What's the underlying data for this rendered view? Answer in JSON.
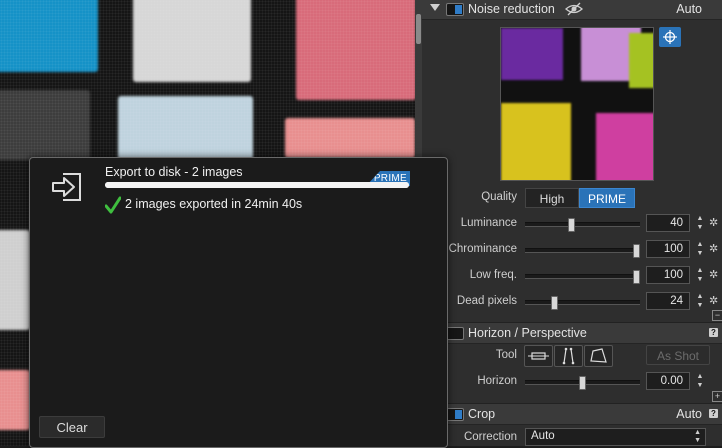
{
  "photo": {
    "colors": {
      "cyan": "#1592c7",
      "white": "#d7d7d7",
      "pink": "#d86b7a",
      "skyblue": "#bfd3de",
      "salmon": "#e88f8f",
      "gray": "#8a8a8a",
      "lightgray": "#cfcfcf"
    }
  },
  "noise_reduction": {
    "title": "Noise reduction",
    "auto": "Auto",
    "visibility_icon": "eye-hidden-icon",
    "picker_icon": "crosshair-icon",
    "quality_label": "Quality",
    "quality_options": [
      "High",
      "PRIME"
    ],
    "quality_selected": "PRIME",
    "sliders": [
      {
        "label": "Luminance",
        "value": "40",
        "level": 0.4
      },
      {
        "label": "Chrominance",
        "value": "100",
        "level": 1.0
      },
      {
        "label": "Low freq.",
        "value": "100",
        "level": 1.0
      },
      {
        "label": "Dead pixels",
        "value": "24",
        "level": 0.24
      }
    ]
  },
  "horizon": {
    "title": "Horizon / Perspective",
    "tool_label": "Tool",
    "as_shot": "As Shot",
    "horizon_label": "Horizon",
    "horizon_value": "0.00",
    "horizon_level": 0.5
  },
  "crop": {
    "title": "Crop",
    "auto": "Auto",
    "correction_label": "Correction",
    "correction_value": "Auto"
  },
  "dialog": {
    "job_title": "Export to disk - 2 images",
    "badge": "PRIME",
    "progress": 1.0,
    "status": "2 images exported in 24min 40s",
    "clear": "Clear"
  },
  "accent": "#2a73b8",
  "success": "#3fbf3f"
}
